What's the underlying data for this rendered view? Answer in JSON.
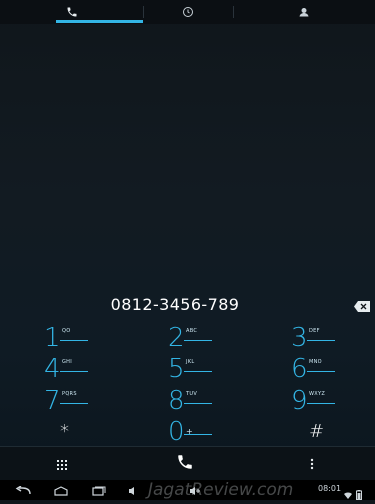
{
  "app": {
    "tabs": [
      {
        "name": "phone-tab",
        "icon": "phone-icon",
        "active": true
      },
      {
        "name": "recent-tab",
        "icon": "clock-icon",
        "active": false
      },
      {
        "name": "contacts-tab",
        "icon": "person-icon",
        "active": false
      }
    ],
    "accent_color": "#33b5e5"
  },
  "dialer": {
    "number": "0812-3456-789",
    "keys": [
      {
        "digit": "1",
        "letters": "QO"
      },
      {
        "digit": "2",
        "letters": "ABC"
      },
      {
        "digit": "3",
        "letters": "DEF"
      },
      {
        "digit": "4",
        "letters": "GHI"
      },
      {
        "digit": "5",
        "letters": "JKL"
      },
      {
        "digit": "6",
        "letters": "MNO"
      },
      {
        "digit": "7",
        "letters": "PQRS"
      },
      {
        "digit": "8",
        "letters": "TUV"
      },
      {
        "digit": "9",
        "letters": "WXYZ"
      },
      {
        "digit": "*",
        "letters": ""
      },
      {
        "digit": "0",
        "letters": "+"
      },
      {
        "digit": "#",
        "letters": ""
      }
    ]
  },
  "system": {
    "time": "08:01",
    "watermark": "JagatReview.com"
  }
}
